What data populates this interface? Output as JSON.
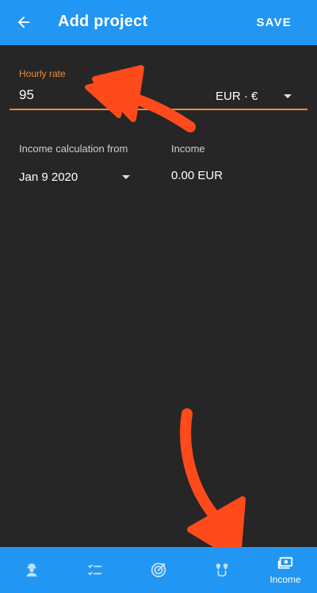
{
  "header": {
    "title": "Add project",
    "save_label": "SAVE",
    "back_icon": "arrow-back-icon",
    "bg_color": "#2196f3"
  },
  "form": {
    "hourly_rate": {
      "label": "Hourly rate",
      "value": "95",
      "accent_color": "#f08a3a"
    },
    "currency": {
      "selected": "EUR · €"
    },
    "income_calc_from": {
      "label": "Income calculation from",
      "selected": "Jan 9 2020"
    },
    "income": {
      "label": "Income",
      "value": "0.00 EUR"
    }
  },
  "bottom_nav": {
    "items": [
      {
        "icon": "worker-icon",
        "label": ""
      },
      {
        "icon": "checklist-icon",
        "label": ""
      },
      {
        "icon": "target-icon",
        "label": ""
      },
      {
        "icon": "route-pins-icon",
        "label": ""
      },
      {
        "icon": "money-icon",
        "label": "Income",
        "active": true
      }
    ]
  },
  "annotations": {
    "arrow_color": "#ff4a1c"
  }
}
